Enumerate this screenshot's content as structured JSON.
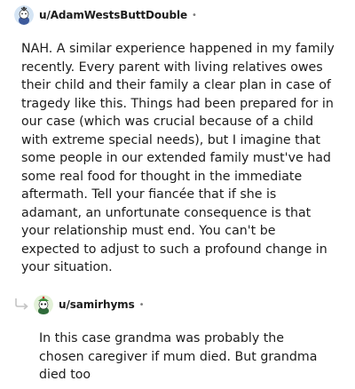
{
  "comments": [
    {
      "author": "u/AdamWestsButtDouble",
      "separator": "•",
      "avatar_icon": "snoo-avatar-icon",
      "body": "NAH. A similar experience happened in my family recently. Every parent with living relatives owes their child and their family a clear plan in case of tragedy like this. Things had been prepared for in our case (which was crucial because of a child with extreme special needs), but I imagine that some people in our extended family must've had some real food for thought in the immediate aftermath. Tell your fiancée that if she is adamant, an unfortunate consequence is that your relationship must end. You can't be expected to adjust to such a profound change in your situation."
    },
    {
      "author": "u/samirhyms",
      "separator": "•",
      "avatar_icon": "snoo-avatar-icon",
      "reply_icon": "reply-arrow-icon",
      "body": "In this case grandma was probably the chosen caregiver if mum died. But grandma died too"
    }
  ],
  "colors": {
    "text": "#1c1c1c",
    "muted": "#7c7c7c",
    "avatar1_bg": "#d4e4f4",
    "avatar2_bg": "#e3f1d8"
  }
}
